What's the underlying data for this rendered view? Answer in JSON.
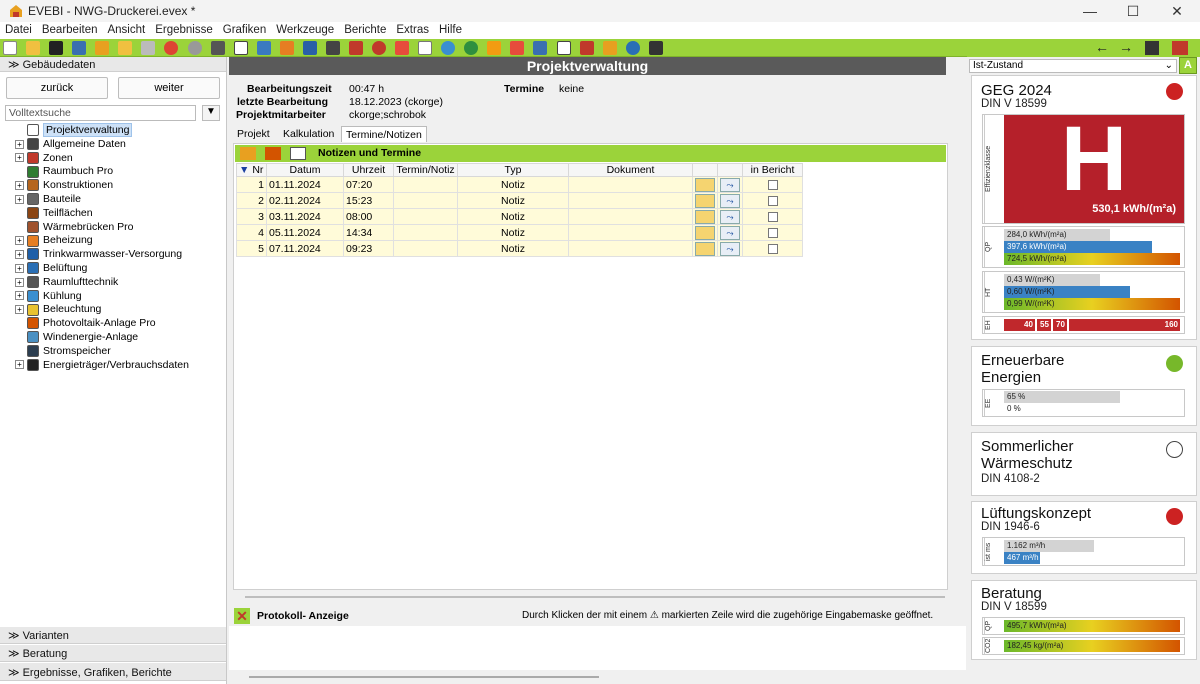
{
  "window": {
    "title": "EVEBI - NWG-Druckerei.evex *",
    "minimize": "—",
    "maximize": "☐",
    "close": "✕"
  },
  "menu": [
    "Datei",
    "Bearbeiten",
    "Ansicht",
    "Ergebnisse",
    "Grafiken",
    "Werkzeuge",
    "Berichte",
    "Extras",
    "Hilfe"
  ],
  "toolbar_nav": {
    "back": "←",
    "forward": "→"
  },
  "left": {
    "header": "Gebäudedaten",
    "back_btn": "zurück",
    "next_btn": "weiter",
    "search_placeholder": "Volltextsuche",
    "tree": [
      {
        "label": "Projektverwaltung",
        "exp": false,
        "selected": true,
        "color": "#ffffff"
      },
      {
        "label": "Allgemeine Daten",
        "exp": true,
        "color": "#444444"
      },
      {
        "label": "Zonen",
        "exp": true,
        "color": "#c0392b"
      },
      {
        "label": "Raumbuch Pro",
        "exp": false,
        "color": "#2f7d32"
      },
      {
        "label": "Konstruktionen",
        "exp": true,
        "color": "#b5651d"
      },
      {
        "label": "Bauteile",
        "exp": true,
        "color": "#666666"
      },
      {
        "label": "Teilflächen",
        "exp": false,
        "color": "#8b4513"
      },
      {
        "label": "Wärmebrücken Pro",
        "exp": false,
        "color": "#a0522d"
      },
      {
        "label": "Beheizung",
        "exp": true,
        "color": "#e67e22"
      },
      {
        "label": "Trinkwarmwasser-Versorgung",
        "exp": true,
        "color": "#1f5fa8"
      },
      {
        "label": "Belüftung",
        "exp": true,
        "color": "#2a6fb5"
      },
      {
        "label": "Raumlufttechnik",
        "exp": true,
        "color": "#555555"
      },
      {
        "label": "Kühlung",
        "exp": true,
        "color": "#3a8fd0"
      },
      {
        "label": "Beleuchtung",
        "exp": true,
        "color": "#e8c230"
      },
      {
        "label": "Photovoltaik-Anlage Pro",
        "exp": false,
        "color": "#d35400"
      },
      {
        "label": "Windenergie-Anlage",
        "exp": false,
        "color": "#4a90c2"
      },
      {
        "label": "Stromspeicher",
        "exp": false,
        "color": "#2c3e50"
      },
      {
        "label": "Energieträger/Verbrauchsdaten",
        "exp": true,
        "color": "#222222"
      }
    ],
    "bottom_sections": [
      "Varianten",
      "Beratung",
      "Ergebnisse, Grafiken, Berichte"
    ]
  },
  "main": {
    "title": "Projektverwaltung",
    "info": {
      "bearbeitungszeit_label": "Bearbeitungszeit",
      "bearbeitungszeit": "00:47 h",
      "letzte_label": "letzte Bearbeitung",
      "letzte": "18.12.2023 (ckorge)",
      "mitarbeiter_label": "Projektmitarbeiter",
      "mitarbeiter": "ckorge;schrobok",
      "termine_label": "Termine",
      "termine": "keine"
    },
    "tabs": [
      "Projekt",
      "Kalkulation",
      "Termine/Notizen"
    ],
    "notes_title": "Notizen und Termine",
    "columns": [
      "Nr",
      "Datum",
      "Uhrzeit",
      "Termin/Notiz",
      "Typ",
      "Dokument",
      "",
      "",
      "in Bericht"
    ],
    "rows": [
      {
        "nr": "1",
        "datum": "01.11.2024",
        "uhrzeit": "07:20",
        "termin": "",
        "typ": "Notiz",
        "dok": ""
      },
      {
        "nr": "2",
        "datum": "02.11.2024",
        "uhrzeit": "15:23",
        "termin": "",
        "typ": "Notiz",
        "dok": ""
      },
      {
        "nr": "3",
        "datum": "03.11.2024",
        "uhrzeit": "08:00",
        "termin": "",
        "typ": "Notiz",
        "dok": ""
      },
      {
        "nr": "4",
        "datum": "05.11.2024",
        "uhrzeit": "14:34",
        "termin": "",
        "typ": "Notiz",
        "dok": ""
      },
      {
        "nr": "5",
        "datum": "07.11.2024",
        "uhrzeit": "09:23",
        "termin": "",
        "typ": "Notiz",
        "dok": ""
      }
    ],
    "protocol_title": "Protokoll- Anzeige",
    "protocol_hint": "Durch Klicken der mit einem ⚠ markierten Zeile wird die zugehörige Eingabemaske geöffnet."
  },
  "right": {
    "state": "Ist-Zustand",
    "a_btn": "A",
    "geg": {
      "title": "GEG 2024",
      "sub": "DIN V 18599",
      "status_color": "#cc2222",
      "class_letter": "H",
      "class_label": "Effizienzklasse",
      "class_value": "530,1 kWh/(m²a)",
      "class_color": "#b5202a",
      "qp_label": "QP",
      "qp": [
        "284,0 kWh/(m²a)",
        "397,6 kWh/(m²a)",
        "724,5 kWh/(m²a)"
      ],
      "ht_label": "HT",
      "ht": [
        "0,43 W/(m²K)",
        "0,60 W/(m²K)",
        "0,99 W/(m²K)"
      ],
      "eh_label": "EH",
      "eh": [
        "40",
        "55",
        "70",
        "160"
      ]
    },
    "ee": {
      "title1": "Erneuerbare",
      "title2": "Energien",
      "status_color": "#77b82a",
      "label": "EE",
      "v1": "65 %",
      "v2": "0 %"
    },
    "sw": {
      "title1": "Sommerlicher",
      "title2": "Wärmeschutz",
      "sub": "DIN 4108-2"
    },
    "lk": {
      "title": "Lüftungskonzept",
      "sub": "DIN 1946-6",
      "status_color": "#cc2222",
      "label": "ist ms",
      "v1": "1.162 m³/h",
      "v2": "467 m³/h"
    },
    "ber": {
      "title": "Beratung",
      "sub": "DIN V 18599",
      "l1": "QP",
      "v1": "495,7 kWh/(m²a)",
      "l2": "CO2",
      "v2": "182,45 kg/(m²a)"
    }
  }
}
